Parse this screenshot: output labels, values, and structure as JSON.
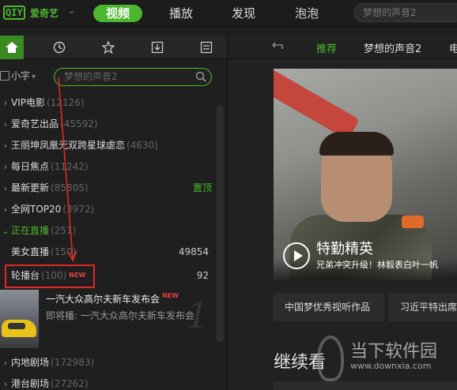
{
  "topbar": {
    "logo_box": "QIY",
    "logo_text": "爱奇艺",
    "tabs": [
      "视频",
      "播放",
      "发现",
      "泡泡"
    ],
    "search_placeholder": "梦想的声音2"
  },
  "left": {
    "font_toggle": "小字",
    "search_placeholder": "梦想的声音2",
    "categories": [
      {
        "label": "VIP电影",
        "count": "(12126)"
      },
      {
        "label": "爱奇艺出品",
        "count": "(45592)"
      },
      {
        "label": "王丽坤凤凰无双跨星球虐恋",
        "count": "(4630)"
      },
      {
        "label": "每日焦点",
        "count": "(11242)"
      },
      {
        "label": "最新更新",
        "count": "(85805)",
        "right": "置顶"
      },
      {
        "label": "全网TOP20",
        "count": "(3972)"
      },
      {
        "label": "正在直播",
        "count": "(251)"
      },
      {
        "label": "美女直播",
        "count": "(150)",
        "right": "49854"
      },
      {
        "label": "轮播台",
        "count": "(100)",
        "badge": "NEW",
        "right": "92"
      }
    ],
    "carousel": {
      "title": "一汽大众高尔夫新车发布会",
      "badge": "NEW",
      "next": "即将播: 一汽大众高尔夫新车发布会",
      "number": "1"
    },
    "more_categories": [
      {
        "label": "内地剧场",
        "count": "(172983)"
      },
      {
        "label": "港台剧场",
        "count": "(27262)"
      }
    ]
  },
  "right": {
    "subtabs": [
      "推荐",
      "梦想的声音2",
      "电"
    ],
    "banner_title": "特勤精英",
    "banner_subtitle": "兄弟冲突升级！林毅表白叶一帆",
    "chips": [
      "中国梦优秀视听作品",
      "习近平特出席"
    ],
    "continue_label": "继续看"
  },
  "watermark": {
    "text": "当下软件园",
    "url": "www.downxia.com"
  },
  "colors": {
    "accent": "#4cb72e",
    "highlight": "#e32626"
  }
}
